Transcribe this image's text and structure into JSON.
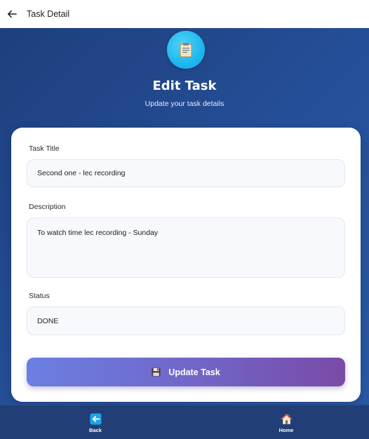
{
  "topbar": {
    "title": "Task Detail",
    "back_icon": "arrow-left-icon"
  },
  "hero": {
    "icon": "clipboard-icon",
    "title": "Edit Task",
    "subtitle": "Update your task details"
  },
  "form": {
    "title_label": "Task Title",
    "title_value": "Second one - lec recording",
    "description_label": "Description",
    "description_value": "To watch time lec recording - Sunday",
    "status_label": "Status",
    "status_value": "DONE",
    "submit_label": "Update Task",
    "submit_icon": "floppy-disk-icon"
  },
  "bottom_nav": {
    "items": [
      {
        "label": "Back",
        "icon": "back-arrow-icon"
      },
      {
        "label": "Home",
        "icon": "house-icon"
      }
    ]
  },
  "colors": {
    "main_bg": "#25509a",
    "hero_icon_bg": "#1eb8ef",
    "button_gradient_start": "#6b7fe2",
    "button_gradient_end": "#7a4aa6",
    "nav_bg": "#213e76"
  }
}
